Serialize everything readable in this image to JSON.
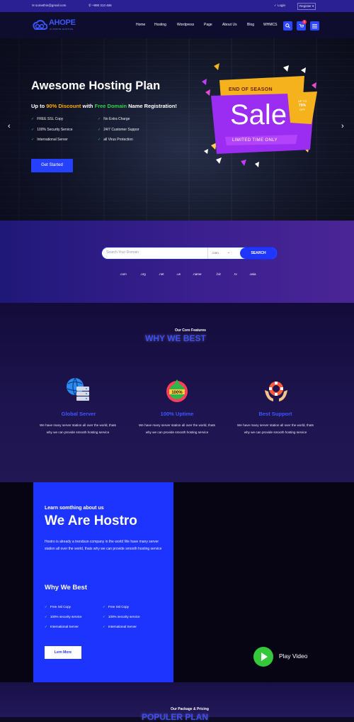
{
  "topbar": {
    "email": "✉ somethin@gmail.com",
    "phone": "✆ +990 313 466",
    "login": "✓ Login",
    "register": "Register ▾"
  },
  "navbar": {
    "logo": "AHOPE",
    "logo_sub": "ULTIMATE HOSTING",
    "links": [
      "Home",
      "Hosting",
      "Wordpress",
      "Page",
      "About Us",
      "Blog",
      "WHMCS"
    ],
    "cart_badge": "0"
  },
  "hero": {
    "title": "Awesome Hosting Plan",
    "subtitle_pre": "Up to ",
    "subtitle_discount": "90% Discount",
    "subtitle_mid": " with ",
    "subtitle_free": "Free Domain",
    "subtitle_post": " Name Registration!",
    "features": [
      "FREE SSL Copy",
      "No Extra Charge",
      "100% Security Service",
      "24/7 Customer Suppor",
      "International Server",
      "all Virus Protection"
    ],
    "cta": "Get Started",
    "badge_top": "END OF SEASON",
    "badge_main": "Sale",
    "badge_bottom": "LIMITED TIME ONLY",
    "badge_off_1": "UP TO",
    "badge_off_2": "70%",
    "badge_off_3": "OFF",
    "prev": "‹",
    "next": "›"
  },
  "domain": {
    "placeholder": "Search Your Domain",
    "select_value": ".com",
    "select_arrow": "⌄",
    "button": "SEARCH",
    "tlds": [
      ".com",
      ".org",
      ".net",
      ".us",
      ".name",
      ".biz",
      ".tv",
      ".asia"
    ]
  },
  "why": {
    "kicker": "Our Core Features",
    "title": "WHY WE BEST",
    "features": [
      {
        "icon": "global-server-icon",
        "title": "Global Server",
        "text": "We have many server station all over the world, thats why we can provide smooth hosting service"
      },
      {
        "icon": "uptime-icon",
        "title": "100% Uptime",
        "text": "We have many server station all over the world, thats why we can provide smooth hosting service"
      },
      {
        "icon": "support-icon",
        "title": "Best Support",
        "text": "We have many server station all over the world, thats why we can provide smooth hosting service"
      }
    ]
  },
  "about": {
    "kicker": "Learn somthing about us",
    "title": "We Are Hostro",
    "text": "Hostro is already a trendsun company in the world We have many server station all over the world, thats why we can provide smooth hosting service",
    "why_title": "Why We Best",
    "list": [
      "Free Ssl Copy",
      "Free Ssl Copy",
      "100% security service",
      "100% security service",
      "International Server",
      "International Server"
    ],
    "learn_more": "Lern More",
    "play": "Play Video"
  },
  "pricing": {
    "kicker": "Our Package & Pricing",
    "title": "POPULER PLAN"
  },
  "colors": {
    "brand_blue": "#1d34ff",
    "accent_green": "#35d24a",
    "accent_orange": "#ffb100",
    "sale_purple": "#9b2cf2"
  }
}
